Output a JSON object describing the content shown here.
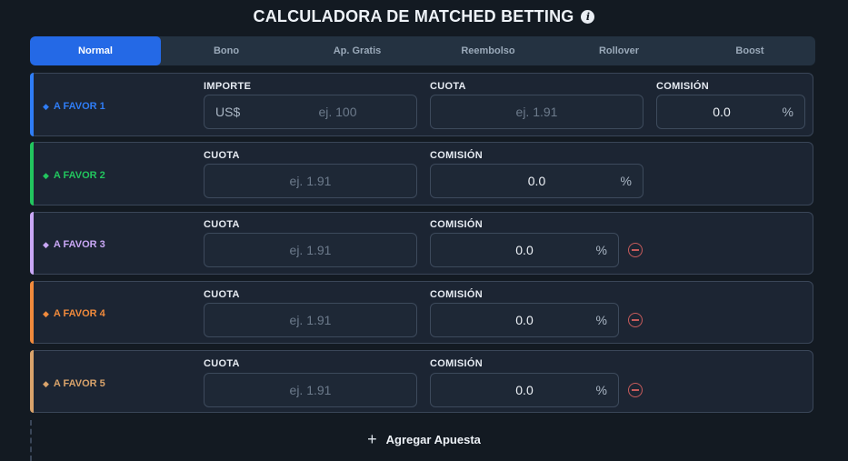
{
  "header": {
    "title": "CALCULADORA DE MATCHED BETTING",
    "info_icon": "info-icon"
  },
  "tabs": [
    {
      "label": "Normal",
      "active": true
    },
    {
      "label": "Bono",
      "active": false
    },
    {
      "label": "Ap. Gratis",
      "active": false
    },
    {
      "label": "Reembolso",
      "active": false
    },
    {
      "label": "Rollover",
      "active": false
    },
    {
      "label": "Boost",
      "active": false
    }
  ],
  "rows": [
    {
      "label": "A FAVOR 1",
      "color": "#2f7df6",
      "importe_label": "IMPORTE",
      "currency": "US$",
      "importe_placeholder": "ej. 100",
      "cuota_label": "CUOTA",
      "cuota_placeholder": "ej. 1.91",
      "comision_label": "COMISIÓN",
      "comision_value": "0.0",
      "unit": "%"
    },
    {
      "label": "A FAVOR 2",
      "color": "#22c55e",
      "cuota_label": "CUOTA",
      "cuota_placeholder": "ej. 1.91",
      "comision_label": "COMISIÓN",
      "comision_value": "0.0",
      "unit": "%"
    },
    {
      "label": "A FAVOR 3",
      "color": "#c9a7f5",
      "cuota_label": "CUOTA",
      "cuota_placeholder": "ej. 1.91",
      "comision_label": "COMISIÓN",
      "comision_value": "0.0",
      "unit": "%"
    },
    {
      "label": "A FAVOR 4",
      "color": "#f08a3c",
      "cuota_label": "CUOTA",
      "cuota_placeholder": "ej. 1.91",
      "comision_label": "COMISIÓN",
      "comision_value": "0.0",
      "unit": "%"
    },
    {
      "label": "A FAVOR 5",
      "color": "#d9a36b",
      "cuota_label": "CUOTA",
      "cuota_placeholder": "ej. 1.91",
      "comision_label": "COMISIÓN",
      "comision_value": "0.0",
      "unit": "%"
    }
  ],
  "add_button": {
    "label": "Agregar Apuesta",
    "icon": "plus-icon"
  },
  "colors": {
    "accent": "#2469e6",
    "remove": "#c75b5b",
    "background": "#131a22"
  }
}
